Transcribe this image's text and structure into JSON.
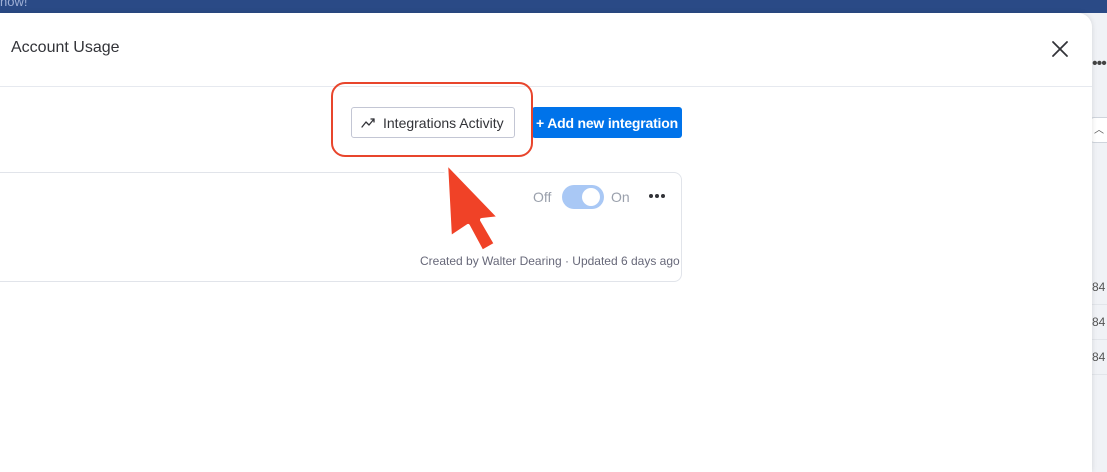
{
  "background": {
    "banner_text": "now!",
    "right_cells": [
      "84",
      "84",
      "84"
    ]
  },
  "modal": {
    "title": "Account Usage",
    "close_icon": "close-icon"
  },
  "toolbar": {
    "activity_label": "Integrations Activity",
    "activity_icon": "trend-up-icon",
    "add_label": "+ Add new integration"
  },
  "integration_card": {
    "toggle_off_label": "Off",
    "toggle_on_label": "On",
    "toggle_state": "on",
    "meta": "Created by Walter Dearing · Updated 6 days ago"
  },
  "colors": {
    "primary": "#0073ea",
    "highlight": "#e8452c",
    "topbar": "#2a4a86",
    "toggle": "#a9c8f5"
  }
}
